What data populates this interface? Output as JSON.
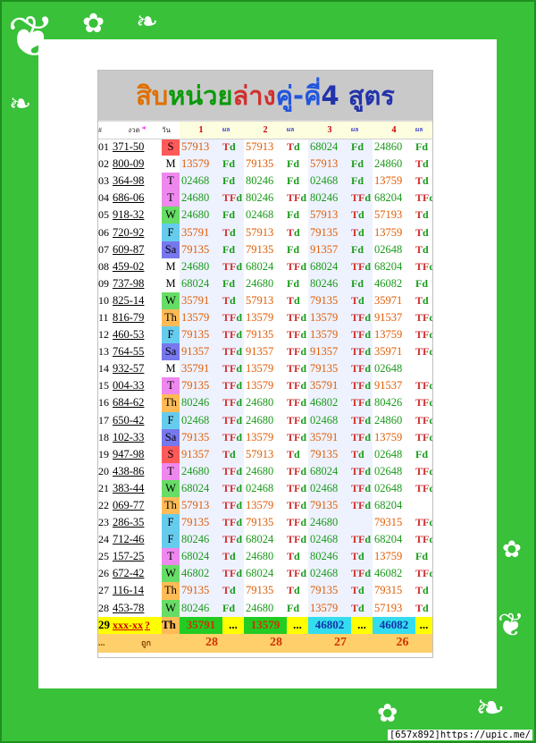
{
  "title": {
    "part1": "สิบ",
    "part2": "หน่วย",
    "part3": "ล่าง",
    "part4": " คู่-คี่",
    "part5": " 4 สูตร"
  },
  "header": {
    "hash": "#",
    "date": "งวด",
    "star": "*",
    "day": "วัน",
    "f1": "1",
    "f2": "2",
    "f3": "3",
    "f4": "4",
    "res": "ผล"
  },
  "rows": [
    [
      "01",
      "371-50",
      "S",
      "57913",
      "Td",
      "57913",
      "Td",
      "68024",
      "Fd",
      "24860",
      "Fd"
    ],
    [
      "02",
      "800-09",
      "M",
      "13579",
      "Fd",
      "79135",
      "Fd",
      "57913",
      "Fd",
      "24860",
      "Td"
    ],
    [
      "03",
      "364-98",
      "T",
      "02468",
      "Fd",
      "80246",
      "Fd",
      "02468",
      "Fd",
      "13759",
      "Td"
    ],
    [
      "04",
      "686-06",
      "T",
      "24680",
      "TFd",
      "80246",
      "TFd",
      "80246",
      "TFd",
      "68204",
      "TFd"
    ],
    [
      "05",
      "918-32",
      "W",
      "24680",
      "Fd",
      "02468",
      "Fd",
      "57913",
      "Td",
      "57193",
      "Td"
    ],
    [
      "06",
      "720-92",
      "F",
      "35791",
      "Td",
      "57913",
      "Td",
      "79135",
      "Td",
      "13759",
      "Td"
    ],
    [
      "07",
      "609-87",
      "Sa",
      "79135",
      "Fd",
      "79135",
      "Fd",
      "91357",
      "Fd",
      "02648",
      "Td"
    ],
    [
      "08",
      "459-02",
      "M",
      "24680",
      "TFd",
      "68024",
      "TFd",
      "68024",
      "TFd",
      "68204",
      "TFd"
    ],
    [
      "09",
      "737-98",
      "M",
      "68024",
      "Fd",
      "24680",
      "Fd",
      "80246",
      "Fd",
      "46082",
      "Fd"
    ],
    [
      "10",
      "825-14",
      "W",
      "35791",
      "Td",
      "57913",
      "Td",
      "79135",
      "Td",
      "35971",
      "Td"
    ],
    [
      "11",
      "816-79",
      "Th",
      "13579",
      "TFd",
      "13579",
      "TFd",
      "13579",
      "TFd",
      "91537",
      "TFd"
    ],
    [
      "12",
      "460-53",
      "F",
      "79135",
      "TFd",
      "79135",
      "TFd",
      "13579",
      "TFd",
      "13759",
      "TFd"
    ],
    [
      "13",
      "764-55",
      "Sa",
      "91357",
      "TFd",
      "91357",
      "TFd",
      "91357",
      "TFd",
      "35971",
      "TFd"
    ],
    [
      "14",
      "932-57",
      "M",
      "35791",
      "TFd",
      "13579",
      "TFd",
      "79135",
      "TFd",
      "02648",
      ""
    ],
    [
      "15",
      "004-33",
      "T",
      "79135",
      "TFd",
      "13579",
      "TFd",
      "35791",
      "TFd",
      "91537",
      "TFd"
    ],
    [
      "16",
      "684-62",
      "Th",
      "80246",
      "TFd",
      "24680",
      "TFd",
      "46802",
      "TFd",
      "80426",
      "TFd"
    ],
    [
      "17",
      "650-42",
      "F",
      "02468",
      "TFd",
      "24680",
      "TFd",
      "02468",
      "TFd",
      "24860",
      "TFd"
    ],
    [
      "18",
      "102-33",
      "Sa",
      "79135",
      "TFd",
      "13579",
      "TFd",
      "35791",
      "TFd",
      "13759",
      "TFd"
    ],
    [
      "19",
      "947-98",
      "S",
      "91357",
      "Td",
      "57913",
      "Td",
      "79135",
      "Td",
      "02648",
      "Fd"
    ],
    [
      "20",
      "438-86",
      "T",
      "24680",
      "TFd",
      "24680",
      "TFd",
      "68024",
      "TFd",
      "02648",
      "TFd"
    ],
    [
      "21",
      "383-44",
      "W",
      "68024",
      "TFd",
      "02468",
      "TFd",
      "02468",
      "TFd",
      "02648",
      "TFd"
    ],
    [
      "22",
      "069-77",
      "Th",
      "57913",
      "TFd",
      "13579",
      "TFd",
      "79135",
      "TFd",
      "68204",
      ""
    ],
    [
      "23",
      "286-35",
      "F",
      "79135",
      "TFd",
      "79135",
      "TFd",
      "24680",
      "",
      "79315",
      "TFd"
    ],
    [
      "24",
      "712-46",
      "F",
      "80246",
      "TFd",
      "68024",
      "TFd",
      "02468",
      "TFd",
      "68204",
      "TFd"
    ],
    [
      "25",
      "157-25",
      "T",
      "68024",
      "Td",
      "24680",
      "Td",
      "80246",
      "Td",
      "13759",
      "Fd"
    ],
    [
      "26",
      "672-42",
      "W",
      "46802",
      "TFd",
      "68024",
      "TFd",
      "02468",
      "TFd",
      "46082",
      "TFd"
    ],
    [
      "27",
      "116-14",
      "Th",
      "79135",
      "Td",
      "79135",
      "Td",
      "79135",
      "Td",
      "79315",
      "Td"
    ],
    [
      "28",
      "453-78",
      "W",
      "80246",
      "Fd",
      "24680",
      "Fd",
      "13579",
      "Td",
      "57193",
      "Td"
    ]
  ],
  "last_row": {
    "idx": "29",
    "date": "xxx-xx",
    "q": "?",
    "day": "Th",
    "n1": "35791",
    "d1": "...",
    "n2": "13579",
    "d2": "...",
    "n3": "46802",
    "d3": "...",
    "n4": "46082",
    "d4": "..."
  },
  "footer": {
    "dots": "...",
    "label": "ถูก",
    "c1": "28",
    "c2": "28",
    "c3": "27",
    "c4": "26"
  },
  "credit": "[657x892]https://upic.me/",
  "colors": {
    "S": "#ff5a5a",
    "M": "#ffffff",
    "T": "#ee88ee",
    "W": "#66dd66",
    "F": "#66ccee",
    "Sa": "#7777ee",
    "Th": "#ffbb55"
  }
}
